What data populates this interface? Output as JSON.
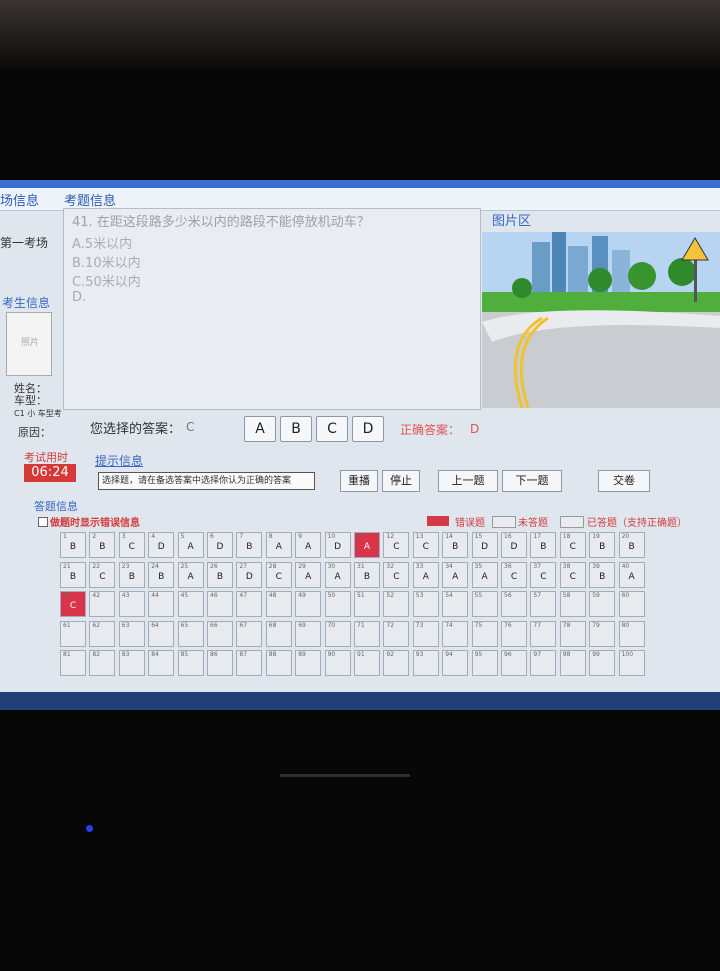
{
  "header": {
    "tab_left": "场信息",
    "tab_exam": "考题信息"
  },
  "left": {
    "exam_room": "第一考场",
    "candidate_info": "考生信息",
    "photo_text": "照片",
    "name_label": "姓名：",
    "car_type_label": "车型：",
    "subject_label": "C1 小 车型考",
    "reason_label": "原因："
  },
  "question": {
    "text": "41. 在距这段路多少米以内的路段不能停放机动车？",
    "options": [
      "A.5米以内",
      "B.10米以内",
      "C.50米以内",
      "D."
    ]
  },
  "picture": {
    "label": "图片区"
  },
  "answer": {
    "your_label": "您选择的答案：",
    "your_value": "C",
    "buttons": [
      "A",
      "B",
      "C",
      "D"
    ],
    "correct_label": "正确答案：",
    "correct_value": "D"
  },
  "timer": {
    "label": "考试用时",
    "value": "06:24"
  },
  "hint": {
    "label": "提示信息",
    "text": "选择题，请在备选答案中选择你认为正确的答案"
  },
  "controls": {
    "replay": "重播",
    "stop": "停止",
    "prev": "上一题",
    "next": "下一题",
    "submit": "交卷"
  },
  "answer_sheet": {
    "title": "答题信息",
    "checkbox_label": "做题时显示错误信息",
    "legend_error": "错误题",
    "legend_unanswered": "未答题",
    "legend_answered": "已答题（支持正确题）",
    "cells": [
      {
        "n": "1",
        "a": "B"
      },
      {
        "n": "2",
        "a": "B"
      },
      {
        "n": "3",
        "a": "C"
      },
      {
        "n": "4",
        "a": "D"
      },
      {
        "n": "5",
        "a": "A"
      },
      {
        "n": "6",
        "a": "D"
      },
      {
        "n": "7",
        "a": "B"
      },
      {
        "n": "8",
        "a": "A"
      },
      {
        "n": "9",
        "a": "A"
      },
      {
        "n": "10",
        "a": "D"
      },
      {
        "n": "11",
        "a": "A",
        "err": true
      },
      {
        "n": "12",
        "a": "C"
      },
      {
        "n": "13",
        "a": "C"
      },
      {
        "n": "14",
        "a": "B"
      },
      {
        "n": "15",
        "a": "D"
      },
      {
        "n": "16",
        "a": "D"
      },
      {
        "n": "17",
        "a": "B"
      },
      {
        "n": "18",
        "a": "C"
      },
      {
        "n": "19",
        "a": "B"
      },
      {
        "n": "20",
        "a": "B"
      },
      {
        "n": "21",
        "a": "B"
      },
      {
        "n": "22",
        "a": "C"
      },
      {
        "n": "23",
        "a": "B"
      },
      {
        "n": "24",
        "a": "B"
      },
      {
        "n": "25",
        "a": "A"
      },
      {
        "n": "26",
        "a": "B"
      },
      {
        "n": "27",
        "a": "D"
      },
      {
        "n": "28",
        "a": "C"
      },
      {
        "n": "29",
        "a": "A"
      },
      {
        "n": "30",
        "a": "A"
      },
      {
        "n": "31",
        "a": "B"
      },
      {
        "n": "32",
        "a": "C"
      },
      {
        "n": "33",
        "a": "A"
      },
      {
        "n": "34",
        "a": "A"
      },
      {
        "n": "35",
        "a": "A"
      },
      {
        "n": "36",
        "a": "C"
      },
      {
        "n": "37",
        "a": "C"
      },
      {
        "n": "38",
        "a": "C"
      },
      {
        "n": "39",
        "a": "B"
      },
      {
        "n": "40",
        "a": "A"
      },
      {
        "n": "41",
        "a": "C",
        "err": true
      },
      {
        "n": "42",
        "a": ""
      },
      {
        "n": "43",
        "a": ""
      },
      {
        "n": "44",
        "a": ""
      },
      {
        "n": "45",
        "a": ""
      },
      {
        "n": "46",
        "a": ""
      },
      {
        "n": "47",
        "a": ""
      },
      {
        "n": "48",
        "a": ""
      },
      {
        "n": "49",
        "a": ""
      },
      {
        "n": "50",
        "a": ""
      },
      {
        "n": "51",
        "a": ""
      },
      {
        "n": "52",
        "a": ""
      },
      {
        "n": "53",
        "a": ""
      },
      {
        "n": "54",
        "a": ""
      },
      {
        "n": "55",
        "a": ""
      },
      {
        "n": "56",
        "a": ""
      },
      {
        "n": "57",
        "a": ""
      },
      {
        "n": "58",
        "a": ""
      },
      {
        "n": "59",
        "a": ""
      },
      {
        "n": "60",
        "a": ""
      },
      {
        "n": "61",
        "a": ""
      },
      {
        "n": "62",
        "a": ""
      },
      {
        "n": "63",
        "a": ""
      },
      {
        "n": "64",
        "a": ""
      },
      {
        "n": "65",
        "a": ""
      },
      {
        "n": "66",
        "a": ""
      },
      {
        "n": "67",
        "a": ""
      },
      {
        "n": "68",
        "a": ""
      },
      {
        "n": "69",
        "a": ""
      },
      {
        "n": "70",
        "a": ""
      },
      {
        "n": "71",
        "a": ""
      },
      {
        "n": "72",
        "a": ""
      },
      {
        "n": "73",
        "a": ""
      },
      {
        "n": "74",
        "a": ""
      },
      {
        "n": "75",
        "a": ""
      },
      {
        "n": "76",
        "a": ""
      },
      {
        "n": "77",
        "a": ""
      },
      {
        "n": "78",
        "a": ""
      },
      {
        "n": "79",
        "a": ""
      },
      {
        "n": "80",
        "a": ""
      },
      {
        "n": "81",
        "a": ""
      },
      {
        "n": "82",
        "a": ""
      },
      {
        "n": "83",
        "a": ""
      },
      {
        "n": "84",
        "a": ""
      },
      {
        "n": "85",
        "a": ""
      },
      {
        "n": "86",
        "a": ""
      },
      {
        "n": "87",
        "a": ""
      },
      {
        "n": "88",
        "a": ""
      },
      {
        "n": "89",
        "a": ""
      },
      {
        "n": "90",
        "a": ""
      },
      {
        "n": "91",
        "a": ""
      },
      {
        "n": "92",
        "a": ""
      },
      {
        "n": "93",
        "a": ""
      },
      {
        "n": "94",
        "a": ""
      },
      {
        "n": "95",
        "a": ""
      },
      {
        "n": "96",
        "a": ""
      },
      {
        "n": "97",
        "a": ""
      },
      {
        "n": "98",
        "a": ""
      },
      {
        "n": "99",
        "a": ""
      },
      {
        "n": "100",
        "a": ""
      }
    ]
  },
  "colors": {
    "accent_blue": "#3a66c4",
    "error_red": "#d23a4a",
    "timer_red": "#d33a38"
  }
}
